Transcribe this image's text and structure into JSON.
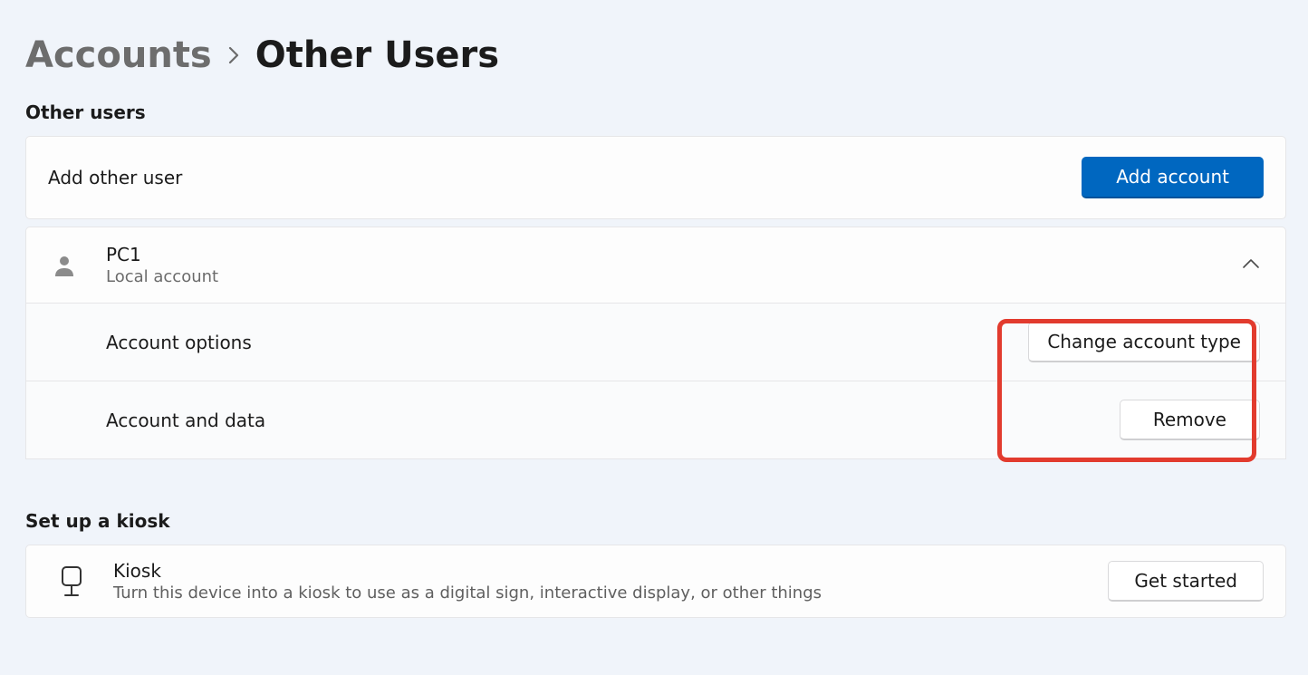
{
  "breadcrumb": {
    "parent": "Accounts",
    "current": "Other Users"
  },
  "other_users": {
    "section_title": "Other users",
    "add_label": "Add other user",
    "add_button": "Add account",
    "user": {
      "name": "PC1",
      "subtitle": "Local account"
    },
    "account_options_label": "Account options",
    "change_type_button": "Change account type",
    "account_data_label": "Account and data",
    "remove_button": "Remove"
  },
  "kiosk": {
    "section_title": "Set up a kiosk",
    "title": "Kiosk",
    "subtitle": "Turn this device into a kiosk to use as a digital sign, interactive display, or other things",
    "get_started_button": "Get started"
  }
}
